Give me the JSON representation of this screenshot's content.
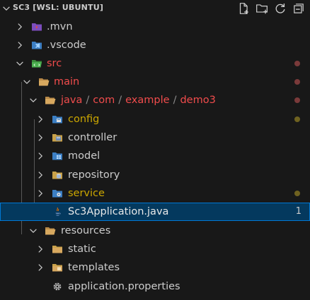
{
  "explorer": {
    "title": "SC3 [WSL: UBUNTU]",
    "actions": [
      "new-file-icon",
      "new-folder-icon",
      "refresh-icon",
      "collapse-all-icon"
    ]
  },
  "colors": {
    "error": "#f14c4c",
    "warning": "#cca700",
    "default": "#cccccc",
    "selected_bg": "#04395e",
    "selected_border": "#0078d4",
    "dot_error": "#7a3a3a",
    "dot_warning": "#6f6220"
  },
  "tree": {
    "mvn": {
      "label": ".mvn",
      "icon": "maven-folder-icon"
    },
    "vscode": {
      "label": ".vscode",
      "icon": "vscode-folder-icon"
    },
    "src": {
      "label": "src",
      "icon": "src-folder-icon"
    },
    "main": {
      "label": "main",
      "icon": "folder-open-icon"
    },
    "java_path": {
      "segments": [
        "java",
        "com",
        "example",
        "demo3"
      ],
      "separator": "/",
      "icon": "folder-open-icon"
    },
    "config": {
      "label": "config",
      "icon": "java-package-icon"
    },
    "controller": {
      "label": "controller",
      "icon": "java-package-icon"
    },
    "model": {
      "label": "model",
      "icon": "java-package-icon"
    },
    "repository": {
      "label": "repository",
      "icon": "java-package-icon"
    },
    "service": {
      "label": "service",
      "icon": "java-package-icon"
    },
    "app_file": {
      "label": "Sc3Application.java",
      "icon": "java-file-icon",
      "badge": "1"
    },
    "resources": {
      "label": "resources",
      "icon": "folder-open-icon"
    },
    "static": {
      "label": "static",
      "icon": "folder-icon"
    },
    "templates": {
      "label": "templates",
      "icon": "folder-icon"
    },
    "app_props": {
      "label": "application.properties",
      "icon": "gear-icon"
    }
  }
}
